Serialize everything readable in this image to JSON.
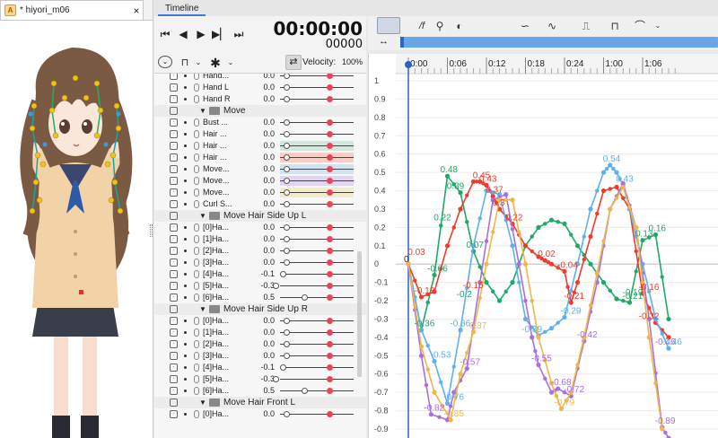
{
  "model_panel": {
    "tab_icon": "A",
    "tab_label": "* hiyori_m06",
    "close_label": "×"
  },
  "timeline": {
    "tab_label": "Timeline",
    "time": "00:00:00",
    "frame": "00000"
  },
  "toolbar": {
    "velocity_label": "Velocity:",
    "velocity_value": "100%"
  },
  "params": [
    {
      "type": "param",
      "name": "Hand...",
      "value": "0.0",
      "knob": 0.0
    },
    {
      "type": "param",
      "name": "Hand L",
      "value": "0.0",
      "knob": 0.0
    },
    {
      "type": "param",
      "name": "Hand R",
      "value": "0.0",
      "knob": 0.0
    },
    {
      "type": "group",
      "name": "Move"
    },
    {
      "type": "param",
      "name": "Bust ...",
      "value": "0.0",
      "knob": 0.0
    },
    {
      "type": "param",
      "name": "Hair ...",
      "value": "0.0",
      "knob": 0.0
    },
    {
      "type": "param",
      "name": "Hair ...",
      "value": "0.0",
      "knob": 0.0,
      "color": "#cfe9dc"
    },
    {
      "type": "param",
      "name": "Hair ...",
      "value": "0.0",
      "knob": 0.0,
      "color": "#f5cfc8"
    },
    {
      "type": "param",
      "name": "Move...",
      "value": "0.0",
      "knob": 0.0,
      "color": "#cfe3f4"
    },
    {
      "type": "param",
      "name": "Move...",
      "value": "0.0",
      "knob": 0.0,
      "color": "#e1d5f2"
    },
    {
      "type": "param",
      "name": "Move...",
      "value": "0.0",
      "knob": 0.0,
      "color": "#f4ebcb"
    },
    {
      "type": "param",
      "name": "Curl S...",
      "value": "0.0",
      "knob": 0.0
    },
    {
      "type": "group",
      "name": "Move Hair Side Up L"
    },
    {
      "type": "param",
      "name": "[0]Ha...",
      "value": "0.0",
      "knob": 0.0
    },
    {
      "type": "param",
      "name": "[1]Ha...",
      "value": "0.0",
      "knob": 0.0
    },
    {
      "type": "param",
      "name": "[2]Ha...",
      "value": "0.0",
      "knob": 0.0
    },
    {
      "type": "param",
      "name": "[3]Ha...",
      "value": "0.0",
      "knob": 0.0
    },
    {
      "type": "param",
      "name": "[4]Ha...",
      "value": "-0.1",
      "knob": -0.1
    },
    {
      "type": "param",
      "name": "[5]Ha...",
      "value": "-0.3",
      "knob": -0.3
    },
    {
      "type": "param",
      "name": "[6]Ha...",
      "value": "0.5",
      "knob": 0.5
    },
    {
      "type": "group",
      "name": "Move Hair Side Up R"
    },
    {
      "type": "param",
      "name": "[0]Ha...",
      "value": "0.0",
      "knob": 0.0
    },
    {
      "type": "param",
      "name": "[1]Ha...",
      "value": "0.0",
      "knob": 0.0
    },
    {
      "type": "param",
      "name": "[2]Ha...",
      "value": "0.0",
      "knob": 0.0
    },
    {
      "type": "param",
      "name": "[3]Ha...",
      "value": "0.0",
      "knob": 0.0
    },
    {
      "type": "param",
      "name": "[4]Ha...",
      "value": "-0.1",
      "knob": -0.1
    },
    {
      "type": "param",
      "name": "[5]Ha...",
      "value": "-0.3",
      "knob": -0.3
    },
    {
      "type": "param",
      "name": "[6]Ha...",
      "value": "0.5",
      "knob": 0.5
    },
    {
      "type": "group",
      "name": "Move Hair Front L"
    },
    {
      "type": "param",
      "name": "[0]Ha...",
      "value": "0.0",
      "knob": 0.0
    }
  ],
  "graph": {
    "time_labels": [
      "0:00",
      "0:06",
      "0:12",
      "0:18",
      "0:24",
      "1:00",
      "1:06"
    ],
    "y_labels": [
      "1",
      "0.9",
      "0.8",
      "0.7",
      "0.6",
      "0.5",
      "0.4",
      "0.3",
      "0.2",
      "0.1",
      "0",
      "-0.1",
      "-0.2",
      "-0.3",
      "-0.4",
      "-0.5",
      "-0.6",
      "-0.7",
      "-0.8",
      "-0.9"
    ],
    "start_marker": "0",
    "series_colors": {
      "green": "#1fa866",
      "red": "#ee3b2b",
      "blue": "#5fb0ee",
      "purple": "#a770e0",
      "orange": "#f0b64a"
    },
    "point_labels": [
      {
        "text": "0.48",
        "x": 6.0,
        "y": 0.48,
        "color": "green"
      },
      {
        "text": "0.39",
        "x": 7.0,
        "y": 0.39,
        "color": "green"
      },
      {
        "text": "0.22",
        "x": 5.0,
        "y": 0.22,
        "color": "green"
      },
      {
        "text": "0.07",
        "x": 10.0,
        "y": 0.07,
        "color": "green"
      },
      {
        "text": "-0.06",
        "x": 4.0,
        "y": -0.06,
        "color": "green"
      },
      {
        "text": "-0.36",
        "x": 2.0,
        "y": -0.36,
        "color": "green"
      },
      {
        "text": "-0.2",
        "x": 8.5,
        "y": -0.2,
        "color": "green"
      },
      {
        "text": "0.45",
        "x": 11.0,
        "y": 0.45,
        "color": "red"
      },
      {
        "text": "0.43",
        "x": 12.0,
        "y": 0.43,
        "color": "red"
      },
      {
        "text": "0.37",
        "x": 13.0,
        "y": 0.37,
        "color": "red"
      },
      {
        "text": "0.03",
        "x": 1.0,
        "y": 0.03,
        "color": "red"
      },
      {
        "text": "-0.18",
        "x": 2.0,
        "y": -0.18,
        "color": "red"
      },
      {
        "text": "-0.15",
        "x": 9.5,
        "y": -0.15,
        "color": "red"
      },
      {
        "text": "0.22",
        "x": 16.0,
        "y": 0.22,
        "color": "red"
      },
      {
        "text": "0.02",
        "x": 21.0,
        "y": 0.02,
        "color": "red"
      },
      {
        "text": "-0.21",
        "x": 25.0,
        "y": -0.21,
        "color": "red"
      },
      {
        "text": "0.3",
        "x": 14.0,
        "y": 0.3,
        "color": "red"
      },
      {
        "text": "-0.04",
        "x": 24.0,
        "y": -0.04,
        "color": "red"
      },
      {
        "text": "0.54",
        "x": 31.0,
        "y": 0.54,
        "color": "blue"
      },
      {
        "text": "0.43",
        "x": 33.0,
        "y": 0.43,
        "color": "blue"
      },
      {
        "text": "-0.53",
        "x": 4.5,
        "y": -0.53,
        "color": "blue"
      },
      {
        "text": "-0.36",
        "x": 7.5,
        "y": -0.36,
        "color": "blue"
      },
      {
        "text": "-0.76",
        "x": 6.5,
        "y": -0.76,
        "color": "blue"
      },
      {
        "text": "-0.29",
        "x": 24.5,
        "y": -0.29,
        "color": "blue"
      },
      {
        "text": "-0.39",
        "x": 18.5,
        "y": -0.39,
        "color": "blue"
      },
      {
        "text": "-0.57",
        "x": 9.0,
        "y": -0.57,
        "color": "purple"
      },
      {
        "text": "-0.82",
        "x": 3.5,
        "y": -0.82,
        "color": "purple"
      },
      {
        "text": "-0.55",
        "x": 20.0,
        "y": -0.55,
        "color": "purple"
      },
      {
        "text": "-0.68",
        "x": 23.0,
        "y": -0.68,
        "color": "purple"
      },
      {
        "text": "-0.72",
        "x": 25.0,
        "y": -0.72,
        "color": "purple"
      },
      {
        "text": "-0.42",
        "x": 27.0,
        "y": -0.42,
        "color": "purple"
      },
      {
        "text": "-0.85",
        "x": 6.5,
        "y": -0.85,
        "color": "orange"
      },
      {
        "text": "-0.37",
        "x": 10.0,
        "y": -0.37,
        "color": "orange"
      },
      {
        "text": "-0.79",
        "x": 23.5,
        "y": -0.79,
        "color": "orange"
      },
      {
        "text": "0.16",
        "x": 38.0,
        "y": 0.16,
        "color": "green"
      },
      {
        "text": "0.13",
        "x": 36.0,
        "y": 0.13,
        "color": "green"
      },
      {
        "text": "-0.19",
        "x": 34.0,
        "y": -0.19,
        "color": "green"
      },
      {
        "text": "-0.46",
        "x": 39.0,
        "y": -0.46,
        "color": "purple"
      },
      {
        "text": "-0.32",
        "x": 36.5,
        "y": -0.32,
        "color": "red"
      },
      {
        "text": "-0.16",
        "x": 36.5,
        "y": -0.16,
        "color": "red"
      },
      {
        "text": "-0.21",
        "x": 34.0,
        "y": -0.21,
        "color": "green"
      },
      {
        "text": "-0.46",
        "x": 40.0,
        "y": -0.46,
        "color": "blue"
      },
      {
        "text": "-0.89",
        "x": 39.0,
        "y": -0.89,
        "color": "purple"
      }
    ]
  },
  "chart_data": {
    "type": "line",
    "xlabel": "",
    "ylabel": "",
    "x_ticks": [
      "0:00",
      "0:06",
      "0:12",
      "0:18",
      "0:24",
      "1:00",
      "1:06"
    ],
    "ylim": [
      -0.95,
      1.05
    ],
    "grid": true,
    "series": [
      {
        "color": "#1fa866",
        "x": [
          0,
          2,
          4,
          6,
          8,
          10,
          12,
          14,
          16,
          18,
          20,
          22,
          24,
          26,
          28,
          30,
          32,
          34,
          36,
          38,
          40
        ],
        "y": [
          0,
          -0.36,
          -0.06,
          0.48,
          0.39,
          0.07,
          -0.1,
          -0.2,
          -0.1,
          0.1,
          0.2,
          0.24,
          0.22,
          0.1,
          0.0,
          -0.1,
          -0.19,
          -0.21,
          0.13,
          0.16,
          -0.3
        ]
      },
      {
        "color": "#ee3b2b",
        "x": [
          0,
          2,
          4,
          6,
          8,
          10,
          11,
          12,
          13,
          14,
          16,
          18,
          20,
          21,
          22,
          24,
          25,
          26,
          28,
          30,
          32,
          34,
          36,
          38,
          40
        ],
        "y": [
          0,
          -0.18,
          -0.15,
          0.1,
          0.3,
          0.45,
          0.45,
          0.43,
          0.37,
          0.3,
          0.22,
          0.1,
          0.04,
          0.02,
          0.0,
          -0.04,
          -0.21,
          -0.1,
          0.15,
          0.4,
          0.42,
          0.3,
          -0.16,
          -0.32,
          -0.4
        ]
      },
      {
        "color": "#5fb0ee",
        "x": [
          0,
          2,
          4,
          6,
          8,
          10,
          12,
          14,
          16,
          18,
          20,
          22,
          24,
          26,
          28,
          30,
          31,
          32,
          33,
          34,
          36,
          38,
          40
        ],
        "y": [
          0,
          -0.36,
          -0.53,
          -0.76,
          -0.36,
          0.1,
          0.4,
          0.38,
          0.1,
          -0.3,
          -0.39,
          -0.35,
          -0.29,
          0.0,
          0.3,
          0.5,
          0.54,
          0.5,
          0.43,
          0.3,
          0.0,
          -0.3,
          -0.46
        ]
      },
      {
        "color": "#a770e0",
        "x": [
          0,
          2,
          3.5,
          6,
          7,
          9,
          11,
          13,
          15,
          17,
          19,
          20,
          22,
          23,
          25,
          27,
          29,
          31,
          33,
          35,
          37,
          39,
          40
        ],
        "y": [
          0,
          -0.5,
          -0.82,
          -0.85,
          -0.7,
          -0.57,
          -0.1,
          0.35,
          0.38,
          0.0,
          -0.4,
          -0.55,
          -0.7,
          -0.68,
          -0.72,
          -0.42,
          -0.1,
          0.3,
          0.44,
          0.2,
          -0.3,
          -0.89,
          -0.95
        ]
      },
      {
        "color": "#f0b64a",
        "x": [
          0,
          2,
          4,
          6.5,
          8,
          10,
          12,
          14,
          16,
          18,
          20,
          22,
          23.5,
          25,
          27,
          29,
          31,
          33,
          35,
          37,
          39
        ],
        "y": [
          0,
          -0.45,
          -0.7,
          -0.85,
          -0.6,
          -0.37,
          0.0,
          0.35,
          0.35,
          0.0,
          -0.4,
          -0.65,
          -0.79,
          -0.7,
          -0.4,
          -0.05,
          0.3,
          0.42,
          0.2,
          -0.4,
          -0.9
        ]
      }
    ]
  }
}
